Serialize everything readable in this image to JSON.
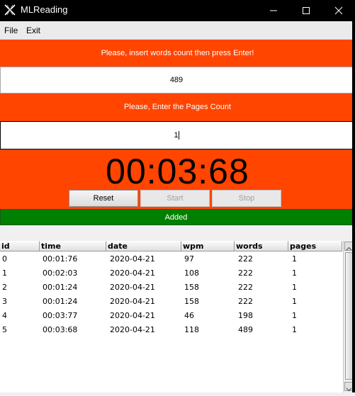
{
  "window": {
    "title": "MLReading"
  },
  "menu": {
    "items": [
      "File",
      "Exit"
    ]
  },
  "words_prompt": "Please, insert words count then press Enter!",
  "words_value": "489",
  "pages_prompt": "Please, Enter the Pages Count",
  "pages_value": "1",
  "timer": "00:03:68",
  "buttons": {
    "reset": "Reset",
    "start": "Start",
    "stop": "Stop"
  },
  "status": "Added",
  "colors": {
    "accent": "#ff4500",
    "status_ok": "#008000",
    "titlebar": "#000000"
  },
  "table": {
    "columns": [
      "id",
      "time",
      "date",
      "wpm",
      "words",
      "pages"
    ],
    "rows": [
      [
        "0",
        "00:01:76",
        "2020-04-21",
        "97",
        "222",
        "1"
      ],
      [
        "1",
        "00:02:03",
        "2020-04-21",
        "108",
        "222",
        "1"
      ],
      [
        "2",
        "00:01:24",
        "2020-04-21",
        "158",
        "222",
        "1"
      ],
      [
        "3",
        "00:01:24",
        "2020-04-21",
        "158",
        "222",
        "1"
      ],
      [
        "4",
        "00:03:77",
        "2020-04-21",
        "46",
        "198",
        "1"
      ],
      [
        "5",
        "00:03:68",
        "2020-04-21",
        "118",
        "489",
        "1"
      ]
    ]
  },
  "icons": [
    "app-logo-icon",
    "minimize-icon",
    "maximize-icon",
    "close-icon",
    "scroll-up-icon",
    "scroll-down-icon"
  ]
}
